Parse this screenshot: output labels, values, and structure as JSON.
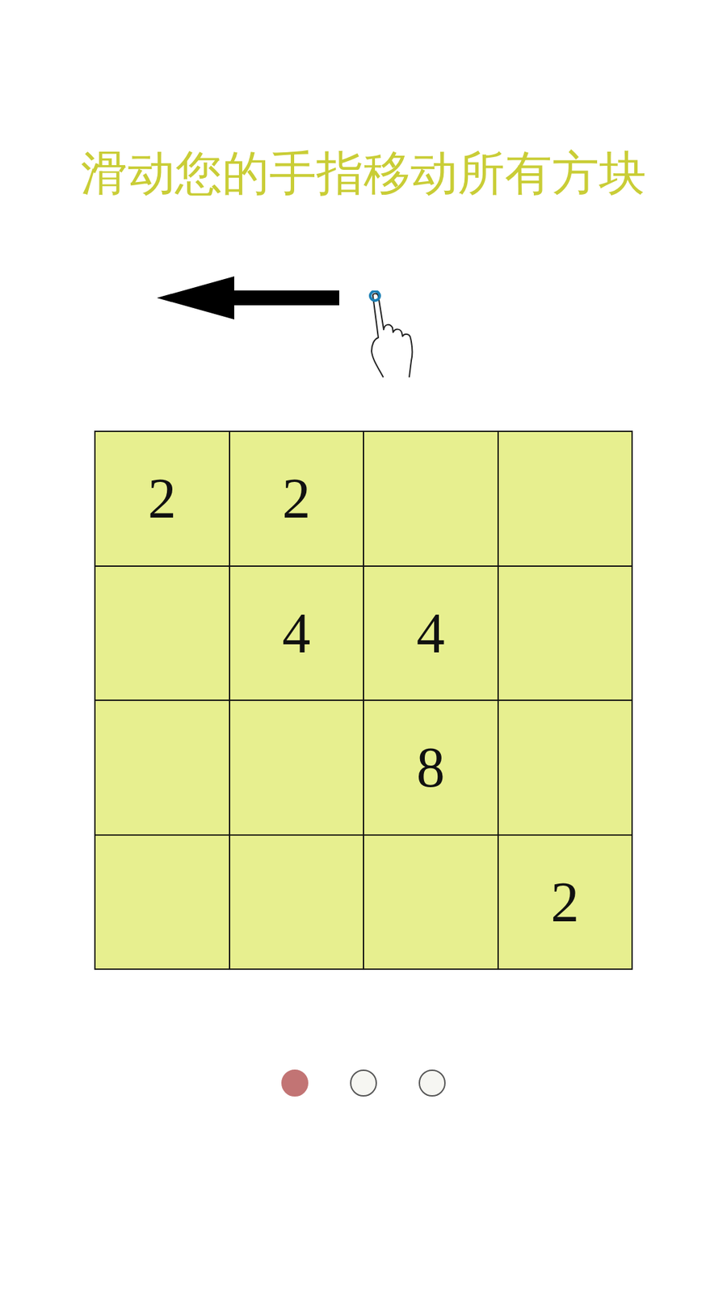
{
  "title": "滑动您的手指移动所有方块",
  "board": {
    "rows": [
      [
        "2",
        "2",
        "",
        ""
      ],
      [
        "",
        "4",
        "4",
        ""
      ],
      [
        "",
        "",
        "8",
        ""
      ],
      [
        "",
        "",
        "",
        "2"
      ]
    ]
  },
  "pager": {
    "dots": [
      {
        "selected": true
      },
      {
        "selected": false
      },
      {
        "selected": false
      }
    ]
  }
}
